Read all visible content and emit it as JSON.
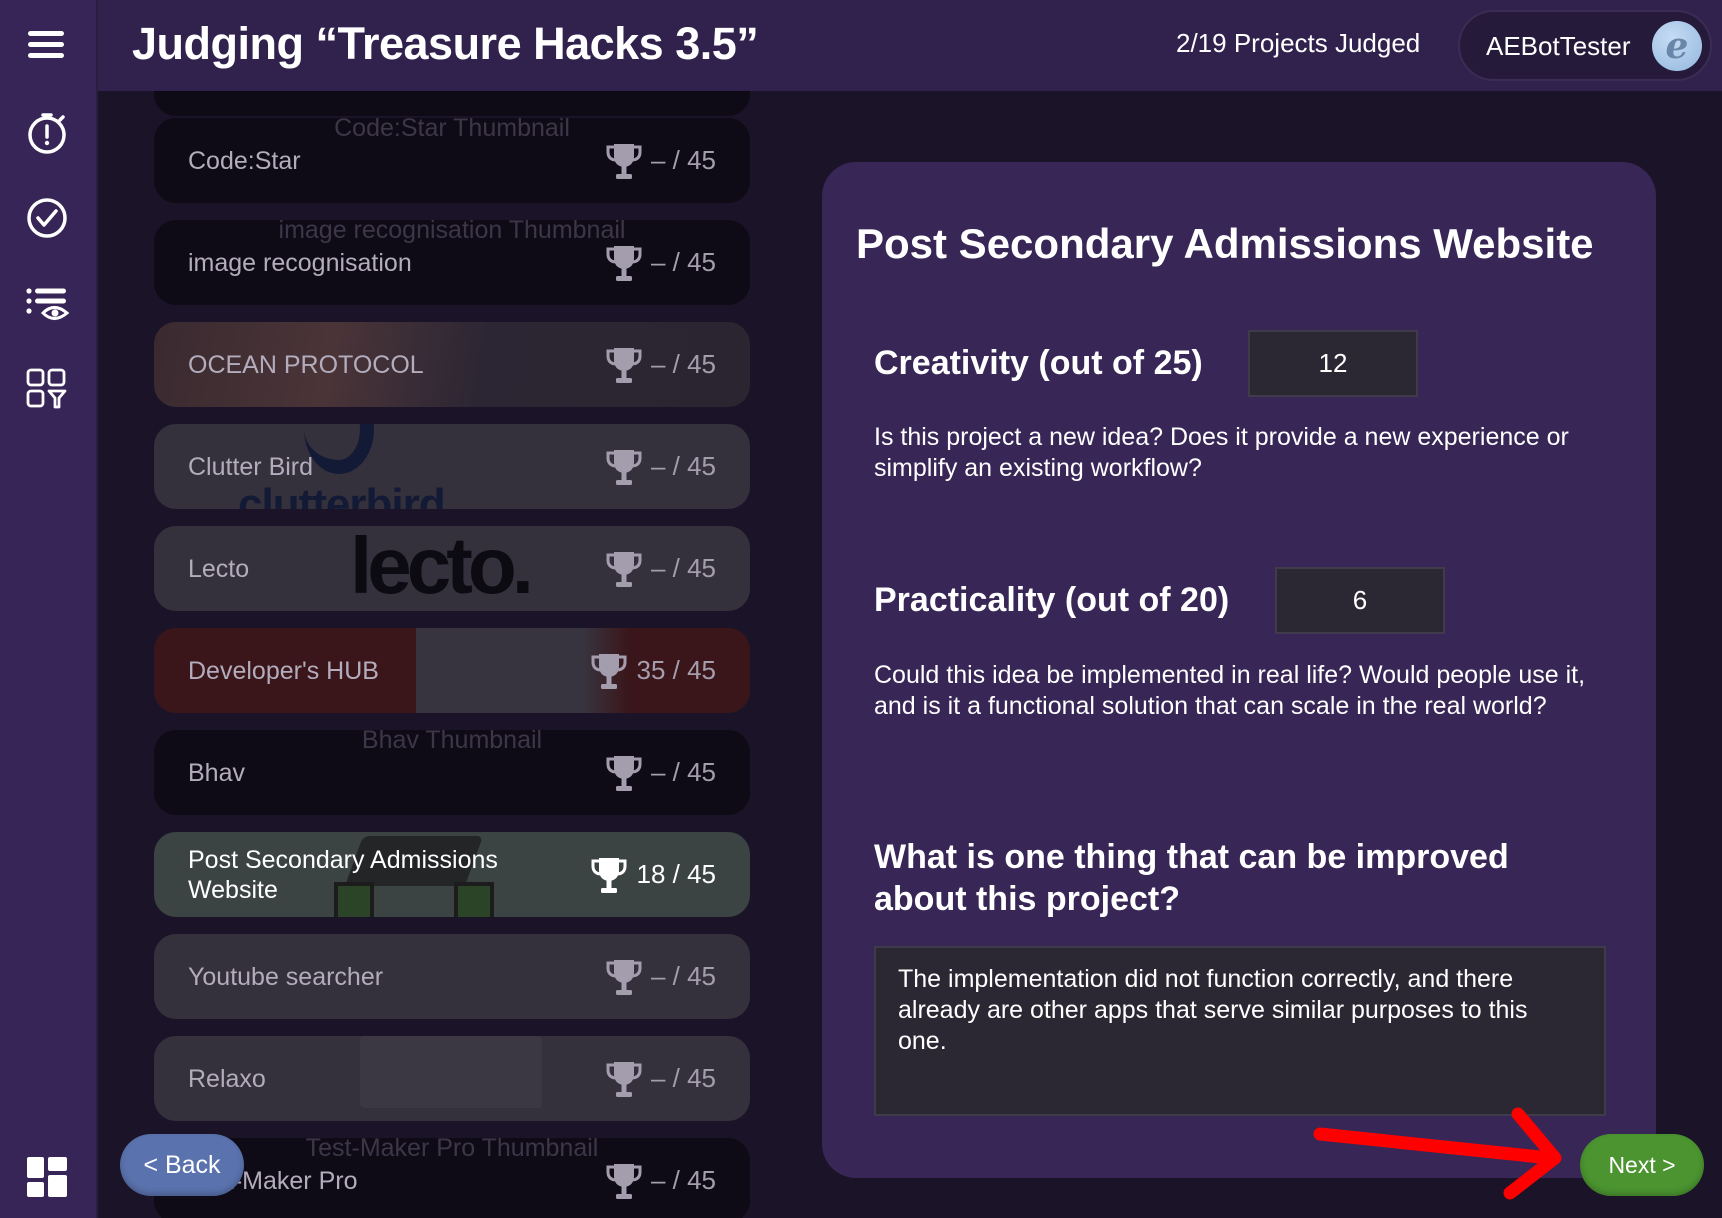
{
  "header": {
    "title": "Judging “Treasure Hacks 3.5”",
    "judged_count": "2/19 Projects Judged",
    "user_name": "AEBotTester",
    "avatar_letter": "e"
  },
  "sidebar": {
    "items": [
      {
        "name": "menu",
        "icon": "hamburger-icon"
      },
      {
        "name": "timer",
        "icon": "stopwatch-alert-icon"
      },
      {
        "name": "judged",
        "icon": "check-circle-icon"
      },
      {
        "name": "review-list",
        "icon": "list-eye-icon"
      },
      {
        "name": "filter-grid",
        "icon": "grid-filter-icon"
      },
      {
        "name": "dashboard",
        "icon": "dashboard-icon"
      }
    ]
  },
  "projects": [
    {
      "name": "Code:Star",
      "thumb_alt": "Code:Star Thumbnail",
      "score": "– / 45",
      "style": "dark"
    },
    {
      "name": "image recognisation",
      "thumb_alt": "image recognisation Thumbnail",
      "score": "– / 45",
      "style": "dark"
    },
    {
      "name": "OCEAN PROTOCOL",
      "thumb_alt": "",
      "score": "– / 45",
      "style": "photo"
    },
    {
      "name": "Clutter Bird",
      "thumb_alt": "",
      "score": "– / 45",
      "style": "grey",
      "logo_text": "clutterbird"
    },
    {
      "name": "Lecto",
      "thumb_alt": "",
      "score": "– / 45",
      "style": "grey",
      "logo_text": "lecto."
    },
    {
      "name": "Developer's HUB",
      "thumb_alt": "",
      "score": "35 / 45",
      "style": "red"
    },
    {
      "name": "Bhav",
      "thumb_alt": "Bhav Thumbnail",
      "score": "– / 45",
      "style": "dark"
    },
    {
      "name": "Post Secondary Admissions Website",
      "thumb_alt": "",
      "score": "18 / 45",
      "style": "selected"
    },
    {
      "name": "Youtube searcher",
      "thumb_alt": "",
      "score": "– / 45",
      "style": "grey"
    },
    {
      "name": "Relaxo",
      "thumb_alt": "",
      "score": "– / 45",
      "style": "grey"
    },
    {
      "name": "Test-Maker Pro",
      "thumb_alt": "Test-Maker Pro Thumbnail",
      "score": "– / 45",
      "style": "dark"
    }
  ],
  "panel": {
    "title": "Post Secondary Admissions Website",
    "criteria": [
      {
        "label": "Creativity (out of 25)",
        "value": "12",
        "description": "Is this project a new idea? Does it provide a new experience or simplify an existing workflow?"
      },
      {
        "label": "Practicality (out of 20)",
        "value": "6",
        "description": "Could this idea be implemented in real life? Would people use it, and is it a functional solution that can scale in the real world?"
      }
    ],
    "feedback_question": "What is one thing that can be improved about this project?",
    "feedback_text": "The implementation did not function correctly, and there already are other apps that serve similar purposes to this one."
  },
  "nav": {
    "back_label": "< Back",
    "next_label": "Next >"
  },
  "colors": {
    "accent_next": "#4b9430",
    "accent_back": "#5a72ad",
    "panel": "#372656",
    "sidebar": "#362556",
    "annotation_arrow": "#ff0000"
  }
}
